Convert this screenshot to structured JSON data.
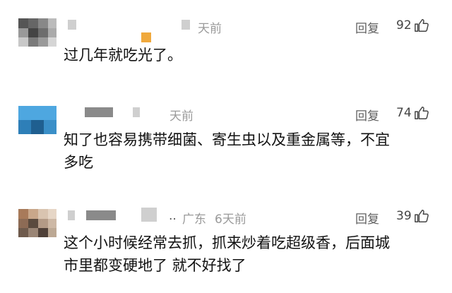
{
  "comments": [
    {
      "time": "天前",
      "reply_label": "回复",
      "likes": "92",
      "text_lines": [
        "过几年就吃光了。"
      ]
    },
    {
      "time": "天前",
      "reply_label": "回复",
      "likes": "74",
      "text_lines": [
        "知了也容易携带细菌、寄生虫以及重金属等，不宜",
        "多吃"
      ]
    },
    {
      "prefix": "..",
      "location": "广东",
      "time": "6天前",
      "reply_label": "回复",
      "likes": "39",
      "text_lines": [
        "这个小时候经常去抓，抓来炒着吃超级香，后面城",
        "市里都变硬地了 就不好找了"
      ]
    }
  ],
  "icons": {
    "like": "thumbs-up-icon"
  },
  "colors": {
    "text": "#121212",
    "meta": "#9a9a9a",
    "reply": "#606060"
  }
}
